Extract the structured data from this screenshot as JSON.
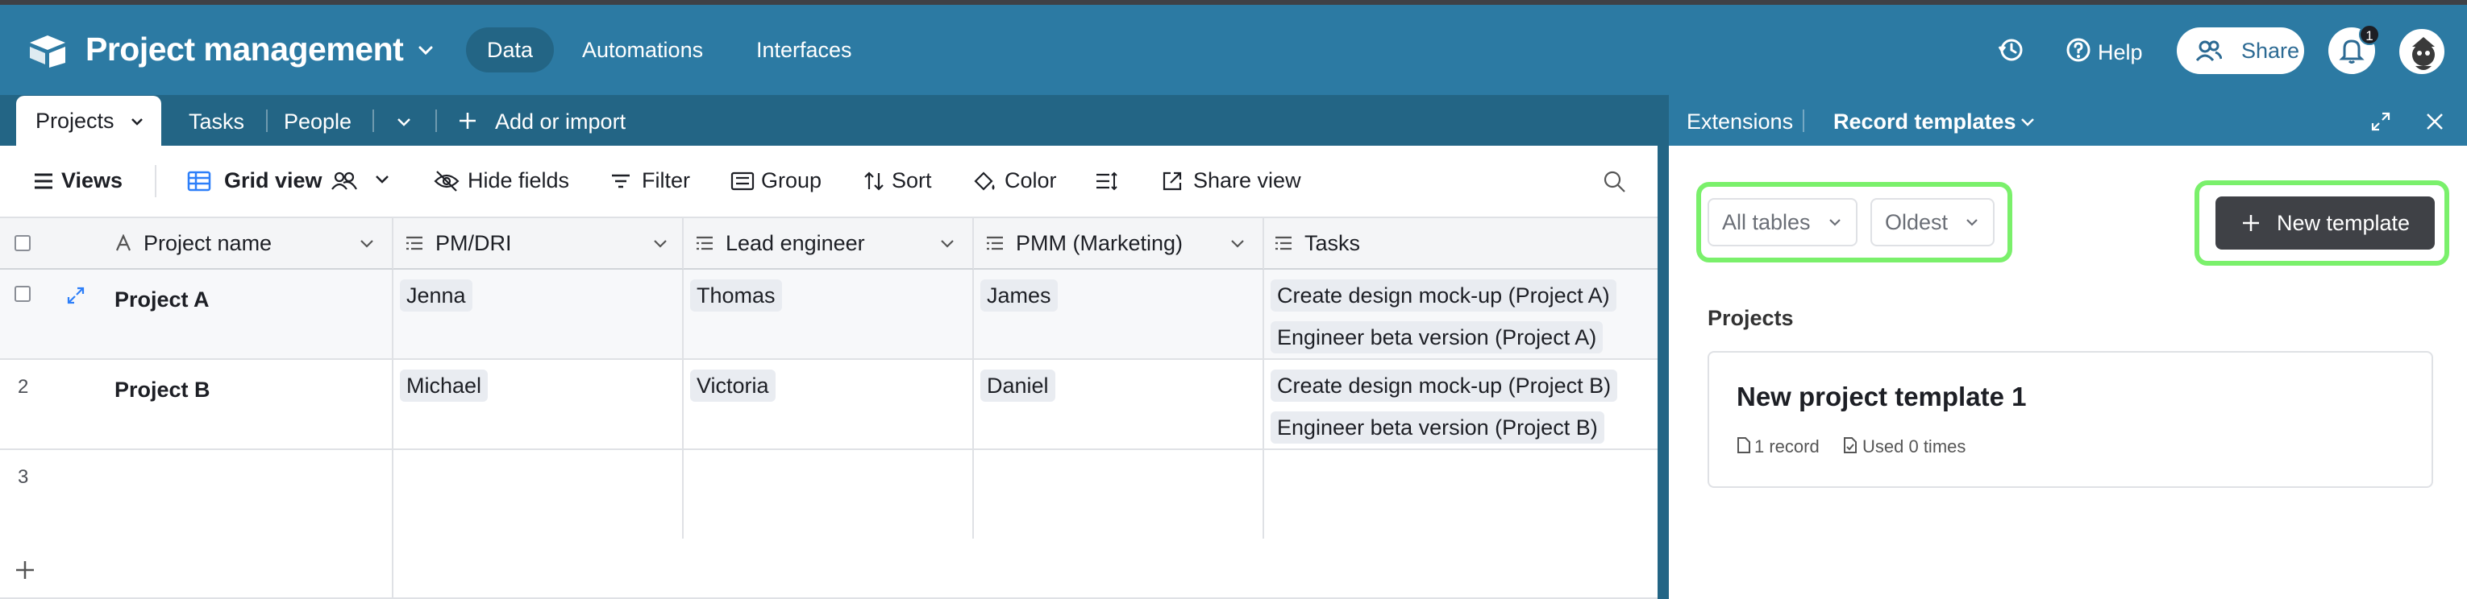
{
  "app": {
    "title": "Project management",
    "nav": [
      "Data",
      "Automations",
      "Interfaces"
    ],
    "help_label": "Help",
    "share_label": "Share",
    "notification_count": "1"
  },
  "tables": {
    "active": "Projects",
    "others": [
      "Tasks",
      "People"
    ],
    "add_label": "Add or import"
  },
  "toolbar": {
    "views_label": "Views",
    "view_name": "Grid view",
    "hide_fields": "Hide fields",
    "filter": "Filter",
    "group": "Group",
    "sort": "Sort",
    "color": "Color",
    "share_view": "Share view"
  },
  "grid": {
    "columns": [
      "Project name",
      "PM/DRI",
      "Lead engineer",
      "PMM (Marketing)",
      "Tasks"
    ],
    "rows": [
      {
        "num": "",
        "name": "Project A",
        "pm": "Jenna",
        "lead": "Thomas",
        "pmm": "James",
        "tasks": [
          "Create design mock-up (Project A)",
          "Engineer beta version (Project A)"
        ]
      },
      {
        "num": "2",
        "name": "Project B",
        "pm": "Michael",
        "lead": "Victoria",
        "pmm": "Daniel",
        "tasks": [
          "Create design mock-up (Project B)",
          "Engineer beta version (Project B)"
        ]
      },
      {
        "num": "3",
        "name": "",
        "pm": "",
        "lead": "",
        "pmm": "",
        "tasks": []
      }
    ]
  },
  "panel": {
    "extensions_label": "Extensions",
    "active_label": "Record templates",
    "filter_tables": "All tables",
    "sort_order": "Oldest",
    "new_template_label": "New template",
    "section_title": "Projects",
    "template": {
      "title": "New project template 1",
      "records": "1 record",
      "usage": "Used 0 times"
    }
  },
  "colors": {
    "header": "#2c7aa3",
    "tabs": "#236585",
    "highlight": "#7af06b",
    "button_dark": "#3f4146"
  }
}
